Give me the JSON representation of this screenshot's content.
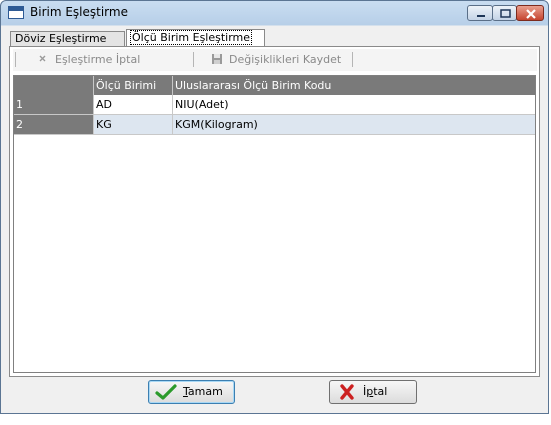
{
  "window": {
    "title": "Birim Eşleştirme",
    "controls": {
      "minimize": "minimize",
      "maximize": "maximize",
      "close": "close"
    }
  },
  "tabs": [
    {
      "label": "Döviz Eşleştirme",
      "active": false
    },
    {
      "label": "Ölçü Birim Eşleştirme",
      "active": true
    }
  ],
  "toolbar": {
    "cancel_match_label": "Eşleştirme İptal",
    "save_changes_label": "Değişiklikleri Kaydet",
    "cancel_match_icon": "x-icon",
    "save_changes_icon": "floppy-disk-icon"
  },
  "grid": {
    "columns": [
      "",
      "Ölçü Birimi",
      "Uluslararası Ölçü Birim Kodu"
    ],
    "rows": [
      {
        "index": "1",
        "unit": "AD",
        "code": "NIU(Adet)"
      },
      {
        "index": "2",
        "unit": "KG",
        "code": "KGM(Kilogram)"
      }
    ]
  },
  "buttons": {
    "ok_first_letter": "T",
    "ok_rest": "amam",
    "ok_icon": "checkmark-icon",
    "cancel_first_letter": "İ",
    "cancel_mid": "p",
    "cancel_rest": "tal",
    "cancel_icon": "red-x-icon"
  },
  "colors": {
    "grid_header": "#7a7a7a",
    "row_alt": "#dde6f0",
    "title_bar": "#c9ddf1",
    "close_button": "#c5442f",
    "ok_check": "#2b9a2b",
    "cancel_x": "#cc2020"
  }
}
